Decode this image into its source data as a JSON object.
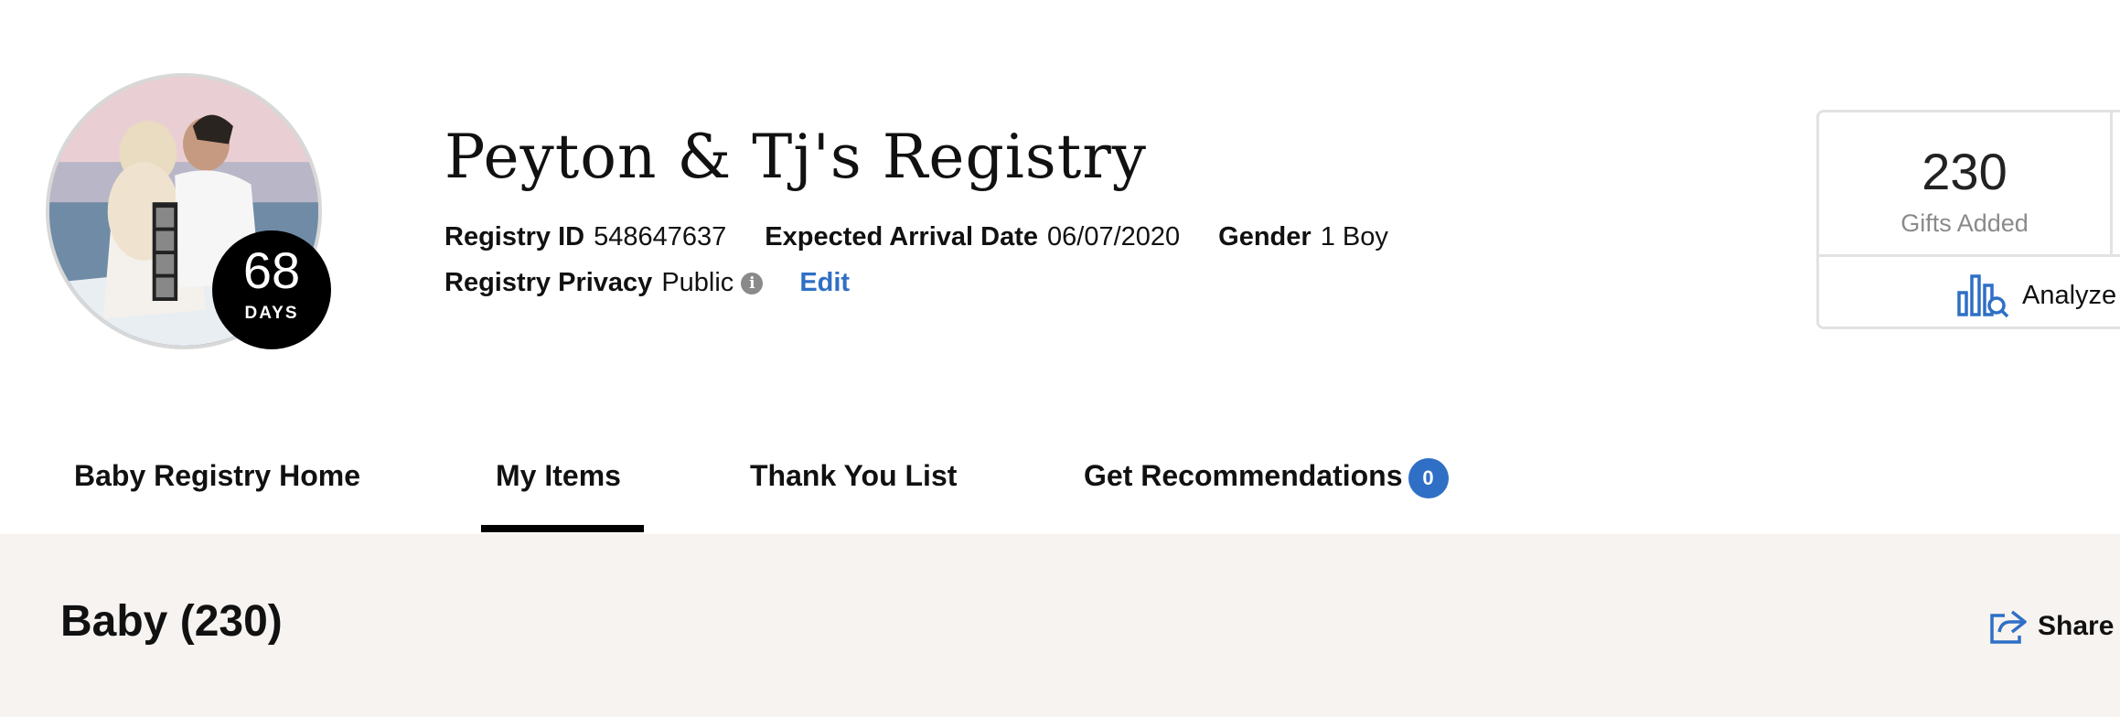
{
  "profile": {
    "days_count": "68",
    "days_label": "DAYS"
  },
  "registry": {
    "title": "Peyton & Tj's Registry",
    "id_label": "Registry ID",
    "id_value": "548647637",
    "arrival_label": "Expected Arrival Date",
    "arrival_value": "06/07/2020",
    "gender_label": "Gender",
    "gender_value": "1 Boy",
    "privacy_label": "Registry Privacy",
    "privacy_value": "Public",
    "info_icon_glyph": "i",
    "edit_label": "Edit"
  },
  "stats": {
    "gifts_count": "230",
    "gifts_label": "Gifts Added",
    "analyze_label": "Analyze"
  },
  "tabs": [
    {
      "label": "Baby Registry Home"
    },
    {
      "label": "My Items",
      "active": true
    },
    {
      "label": "Thank You List"
    },
    {
      "label": "Get Recommendations",
      "badge": "0"
    }
  ],
  "section": {
    "title": "Baby (230)",
    "share_label": "Share"
  },
  "colors": {
    "accent": "#2f6fc6",
    "section_bg": "#f7f3f0",
    "active_tab_underline": "#000000"
  },
  "icons": [
    "info-icon",
    "bar-chart-search-icon",
    "share-icon"
  ]
}
